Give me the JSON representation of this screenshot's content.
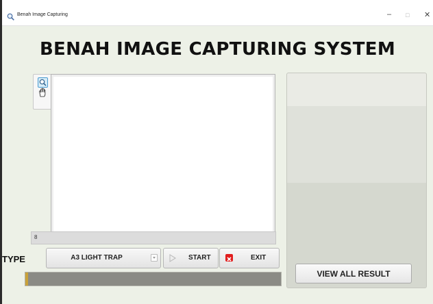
{
  "window": {
    "title": "Benah Image Capturing",
    "minimize_glyph": "–",
    "maximize_glyph": "□",
    "close_glyph": "✕"
  },
  "heading": "BENAH IMAGE CAPTURING SYSTEM",
  "tools": [
    "zoom-icon",
    "hand-pan-icon"
  ],
  "status_bar": {
    "text": "8"
  },
  "type": {
    "label": "TYPE",
    "selected": "A3 LIGHT TRAP"
  },
  "buttons": {
    "start": "START",
    "exit": "EXIT",
    "view_all": "VIEW ALL RESULT"
  },
  "progress": {
    "fraction": 0.01
  },
  "colors": {
    "window_bg": "#edf1e7",
    "progress_track": "#8b8b85",
    "progress_fill": "#c9a23a",
    "exit_icon": "#e11e1e",
    "zoom_active": "#4a9bd1"
  }
}
